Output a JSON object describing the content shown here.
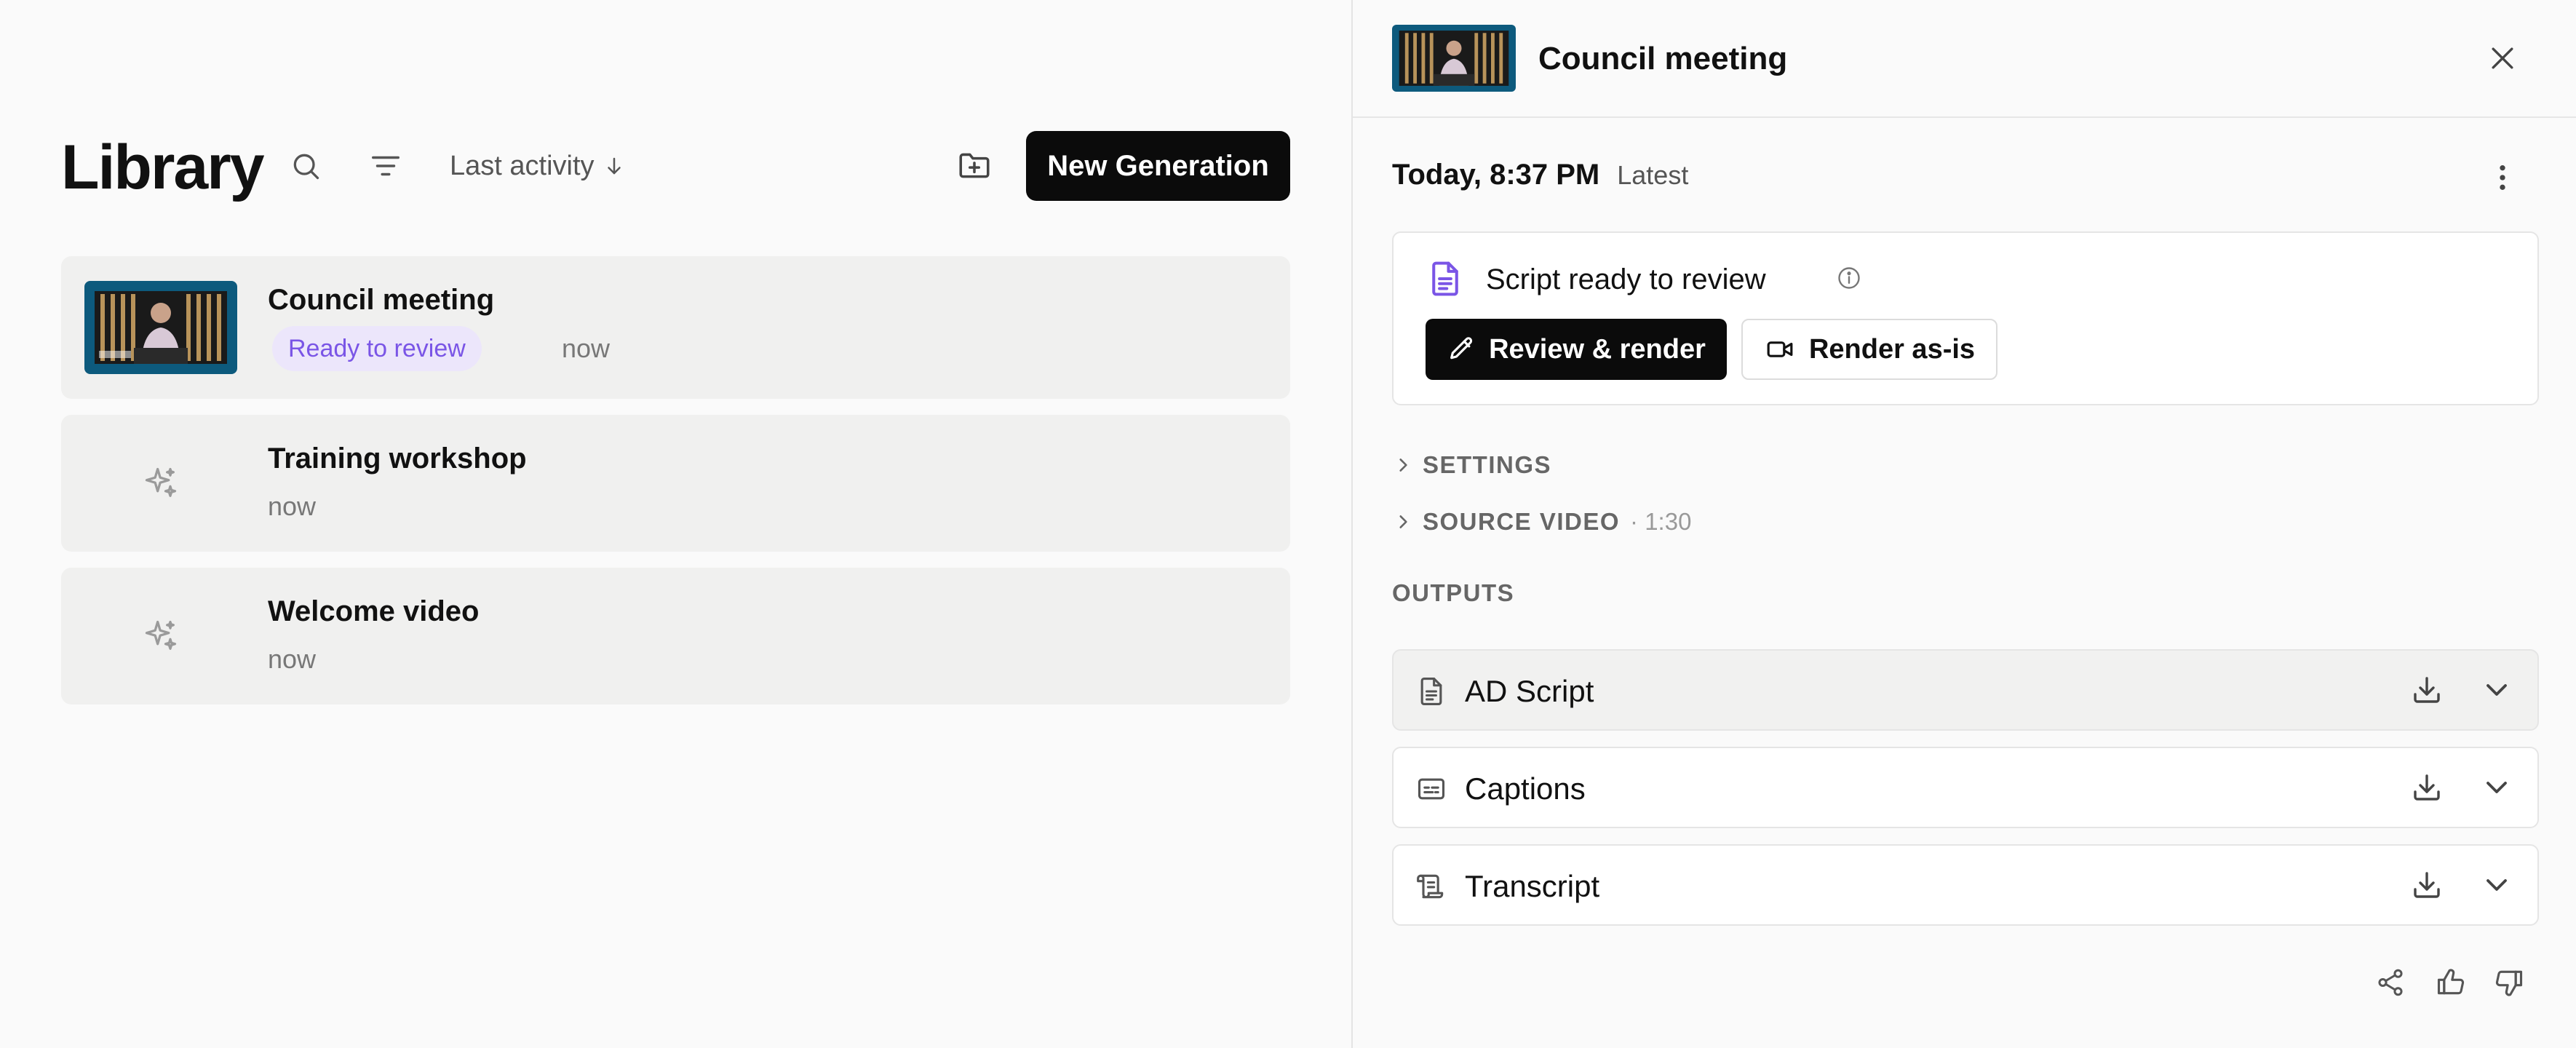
{
  "library": {
    "title": "Library",
    "sort_label": "Last activity",
    "new_button": "New Generation",
    "items": [
      {
        "title": "Council meeting",
        "badge": "Ready to review",
        "time": "now"
      },
      {
        "title": "Training workshop",
        "time": "now"
      },
      {
        "title": "Welcome video",
        "time": "now"
      }
    ]
  },
  "panel": {
    "title": "Council meeting",
    "version_date": "Today, 8:37 PM",
    "version_tag": "Latest",
    "review_status": "Script ready to review",
    "review_button": "Review & render",
    "render_button": "Render as-is",
    "settings_label": "SETTINGS",
    "source_label": "SOURCE VIDEO",
    "source_duration": "· 1:30",
    "outputs_label": "OUTPUTS",
    "outputs": [
      {
        "name": "AD Script",
        "icon": "document-icon"
      },
      {
        "name": "Captions",
        "icon": "captions-icon"
      },
      {
        "name": "Transcript",
        "icon": "scroll-icon"
      }
    ]
  },
  "colors": {
    "accent": "#7a55e6",
    "badge_bg": "#ece6fb",
    "primary_button": "#0b0b0b"
  }
}
